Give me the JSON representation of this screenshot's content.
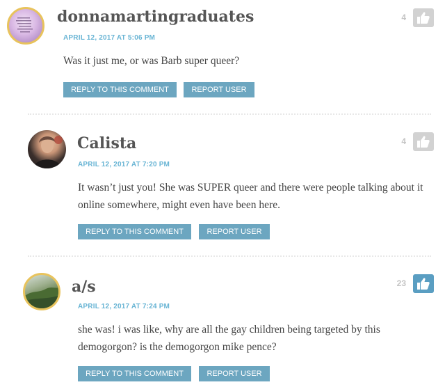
{
  "comments": [
    {
      "author": "donnamartingraduates",
      "date": "APRIL 12, 2017 AT 5:06 PM",
      "text": "Was it just me, or was Barb super queer?",
      "likes": "4",
      "reply_label": "REPLY TO THIS COMMENT",
      "report_label": "REPORT USER"
    },
    {
      "author": "Calista",
      "date": "APRIL 12, 2017 AT 7:20 PM",
      "text": "It wasn’t just you! She was SUPER queer and there were people talking about it online somewhere, might even have been here.",
      "likes": "4",
      "reply_label": "REPLY TO THIS COMMENT",
      "report_label": "REPORT USER"
    },
    {
      "author": "a/s",
      "date": "APRIL 12, 2017 AT 7:24 PM",
      "text": "she was! i was like, why are all the gay children being targeted by this demogorgon? is the demogorgon mike pence?",
      "likes": "23",
      "reply_label": "REPLY TO THIS COMMENT",
      "report_label": "REPORT USER"
    }
  ],
  "colors": {
    "avatar_border": "#e8c35c",
    "date": "#68b4d4",
    "button": "#6ca6c0",
    "like_inactive": "#d2d2d2",
    "like_active": "#5a9ec2"
  },
  "icons": {
    "like": "thumbs-up-icon"
  }
}
